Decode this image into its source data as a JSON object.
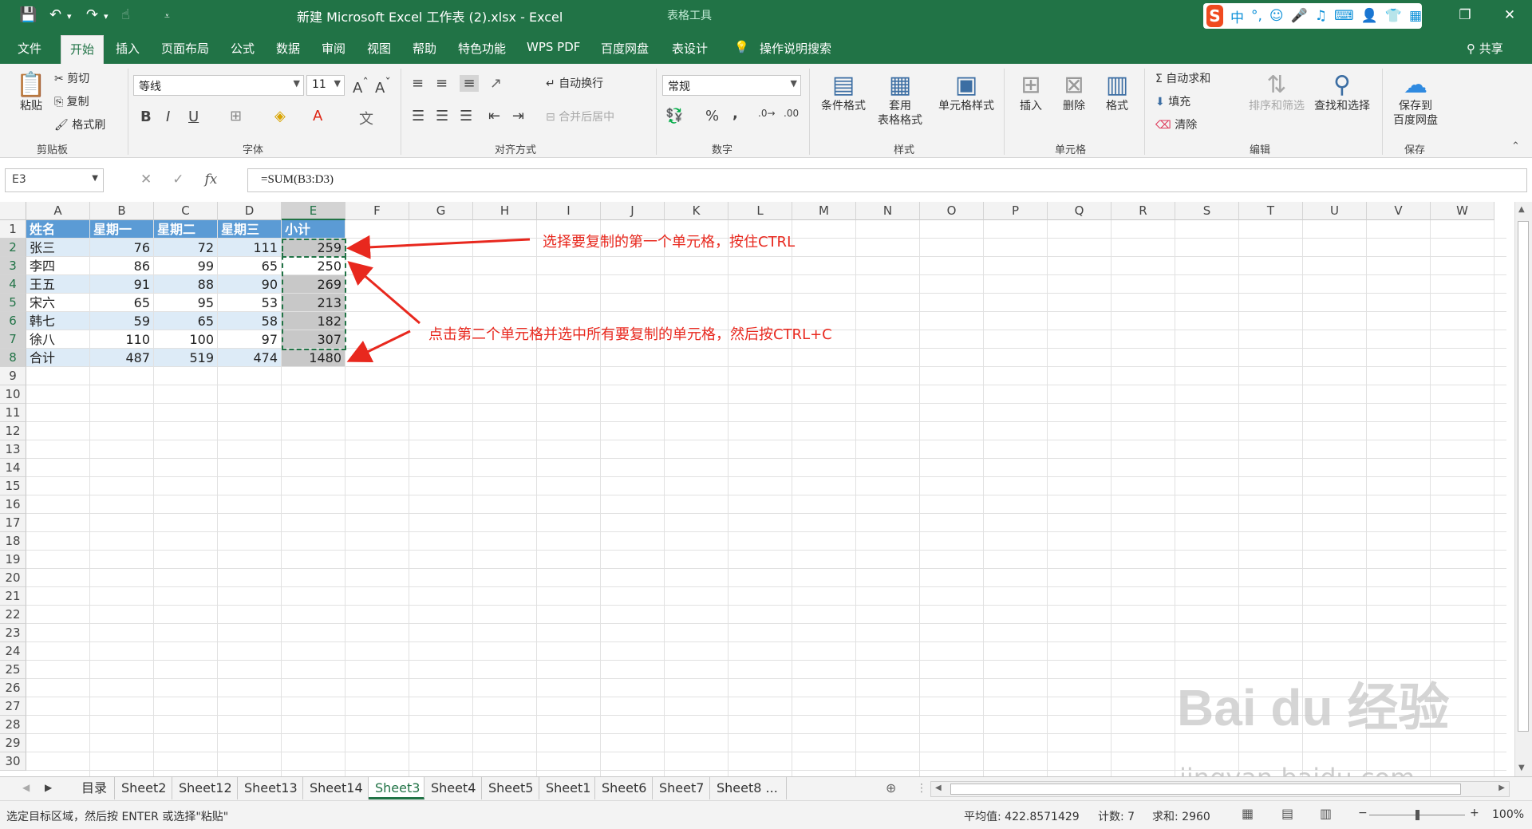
{
  "titlebar": {
    "title": "新建 Microsoft Excel 工作表 (2).xlsx  -  Excel",
    "context_tools": "表格工具",
    "qat_icons": [
      "save-icon",
      "undo-icon",
      "redo-icon",
      "customize-icon"
    ],
    "window_controls": [
      "ribbon-display-icon",
      "minimize-icon",
      "restore-icon",
      "close-icon"
    ],
    "ime": {
      "logo": "S",
      "mode": "中",
      "punct": "°,"
    }
  },
  "tabs": [
    "文件",
    "开始",
    "插入",
    "页面布局",
    "公式",
    "数据",
    "审阅",
    "视图",
    "帮助",
    "特色功能",
    "WPS PDF",
    "百度网盘",
    "表设计"
  ],
  "active_tab": "开始",
  "tell_me": "操作说明搜索",
  "share": "共享",
  "ribbon": {
    "clipboard": {
      "paste": "粘贴",
      "cut": "剪切",
      "copy": "复制",
      "format_painter": "格式刷",
      "label": "剪贴板"
    },
    "font": {
      "name": "等线",
      "size": "11",
      "bold": "B",
      "italic": "I",
      "underline": "U",
      "label": "字体"
    },
    "alignment": {
      "wrap": "自动换行",
      "merge": "合并后居中",
      "label": "对齐方式"
    },
    "number": {
      "format": "常规",
      "percent": "%",
      "comma": ",",
      "label": "数字"
    },
    "styles": {
      "conditional": "条件格式",
      "table_format_1": "套用",
      "table_format_2": "表格格式",
      "cell_styles": "单元格样式",
      "label": "样式"
    },
    "cells": {
      "insert": "插入",
      "delete": "删除",
      "format": "格式",
      "label": "单元格"
    },
    "editing": {
      "autosum": "自动求和",
      "fill": "填充",
      "clear": "清除",
      "sort": "排序和筛选",
      "find": "查找和选择",
      "label": "编辑"
    },
    "save": {
      "line1": "保存到",
      "line2": "百度网盘",
      "label": "保存"
    }
  },
  "formula_bar": {
    "name_box": "E3",
    "formula": "=SUM(B3:D3)"
  },
  "columns": [
    "A",
    "B",
    "C",
    "D",
    "E",
    "F",
    "G",
    "H",
    "I",
    "J",
    "K",
    "L",
    "M",
    "N",
    "O",
    "P",
    "Q",
    "R",
    "S",
    "T",
    "U",
    "V",
    "W"
  ],
  "rows": [
    "1",
    "2",
    "3",
    "4",
    "5",
    "6",
    "7",
    "8",
    "9",
    "10",
    "11",
    "12",
    "13",
    "14",
    "15",
    "16",
    "17",
    "18",
    "19",
    "20",
    "21",
    "22",
    "23",
    "24",
    "25",
    "26",
    "27",
    "28",
    "29",
    "30"
  ],
  "table": {
    "header": [
      "姓名",
      "星期一",
      "星期二",
      "星期三",
      "小计"
    ],
    "rows": [
      [
        "张三",
        "76",
        "72",
        "111",
        "259"
      ],
      [
        "李四",
        "86",
        "99",
        "65",
        "250"
      ],
      [
        "王五",
        "91",
        "88",
        "90",
        "269"
      ],
      [
        "宋六",
        "65",
        "95",
        "53",
        "213"
      ],
      [
        "韩七",
        "59",
        "65",
        "58",
        "182"
      ],
      [
        "徐八",
        "110",
        "100",
        "97",
        "307"
      ],
      [
        "合计",
        "487",
        "519",
        "474",
        "1480"
      ]
    ]
  },
  "annotations": {
    "first": "选择要复制的第一个单元格，按住CTRL",
    "second": "点击第二个单元格并选中所有要复制的单元格，然后按CTRL+C",
    "color": "#e8281e"
  },
  "sheets": [
    "目录",
    "Sheet2",
    "Sheet12",
    "Sheet13",
    "Sheet14",
    "Sheet3",
    "Sheet4",
    "Sheet5",
    "Sheet1",
    "Sheet6",
    "Sheet7",
    "Sheet8 ..."
  ],
  "active_sheet": "Sheet3",
  "status": {
    "message": "选定目标区域，然后按 ENTER 或选择\"粘贴\"",
    "average": "平均值: 422.8571429",
    "count": "计数: 7",
    "sum": "求和: 2960",
    "zoom": "100%"
  },
  "watermark": {
    "main": "Bai du 经验",
    "sub": "jingyan.baidu.com"
  },
  "colors": {
    "excel_green": "#217346",
    "table_header": "#5b9bd5",
    "table_band": "#ddebf7"
  }
}
